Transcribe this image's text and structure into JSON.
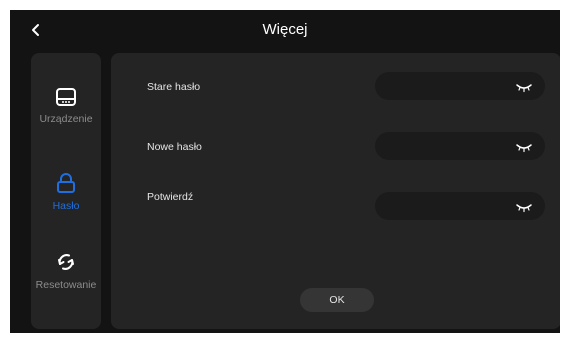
{
  "header": {
    "title": "Więcej",
    "back_icon": "chevron-left-icon"
  },
  "sidebar": {
    "items": [
      {
        "label": "Urządzenie",
        "icon": "device-icon",
        "active": false
      },
      {
        "label": "Hasło",
        "icon": "lock-icon",
        "active": true
      },
      {
        "label": "Resetowanie",
        "icon": "reset-icon",
        "active": false
      }
    ]
  },
  "form": {
    "fields": [
      {
        "label": "Stare hasło",
        "value": "",
        "placeholder": "",
        "toggle_icon": "eye-closed-icon"
      },
      {
        "label": "Nowe hasło",
        "value": "",
        "placeholder": "",
        "toggle_icon": "eye-closed-icon"
      },
      {
        "label": "Potwierdź",
        "value": "",
        "placeholder": "",
        "toggle_icon": "eye-closed-icon"
      }
    ],
    "submit_label": "OK"
  },
  "colors": {
    "background": "#131313",
    "panel": "#242424",
    "input": "#1b1b1b",
    "accent": "#1f6fe0",
    "muted_text": "#8c8c8c",
    "text": "#e6e6e6",
    "button": "#353535"
  }
}
